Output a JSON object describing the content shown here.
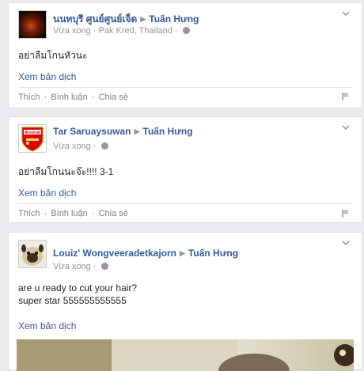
{
  "posts": [
    {
      "author": "นนทบุรี ศูนย์ศูนย์เจ็ด",
      "target": "Tuấn Hưng",
      "time": "Vừa xong",
      "location": "Pak Kred, Thailand",
      "message": [
        "อย่าลืมโกนหัวนะ"
      ],
      "translate": "Xem bản dịch",
      "actions": [
        "Thích",
        "Bình luận",
        "Chia sẻ"
      ]
    },
    {
      "author": "Tar Saruaysuwan",
      "target": "Tuấn Hưng",
      "time": "Vừa xong",
      "avatar_text": "Arsenal",
      "message": [
        "อย่าลืมโกนนะจ๊ะ!!!! 3-1"
      ],
      "translate": "Xem bản dịch",
      "actions": [
        "Thích",
        "Bình luận",
        "Chia sẻ"
      ]
    },
    {
      "author": "Louiz' Wongveeradetkajorn",
      "target": "Tuấn Hưng",
      "time": "Vừa xong",
      "message": [
        "are u ready to cut your hair?",
        "super star 555555555555"
      ],
      "translate": "Xem bản dịch"
    }
  ],
  "colors": {
    "link": "#365899",
    "bg": "#e9ebee",
    "arsenal_red": "#db0007"
  }
}
